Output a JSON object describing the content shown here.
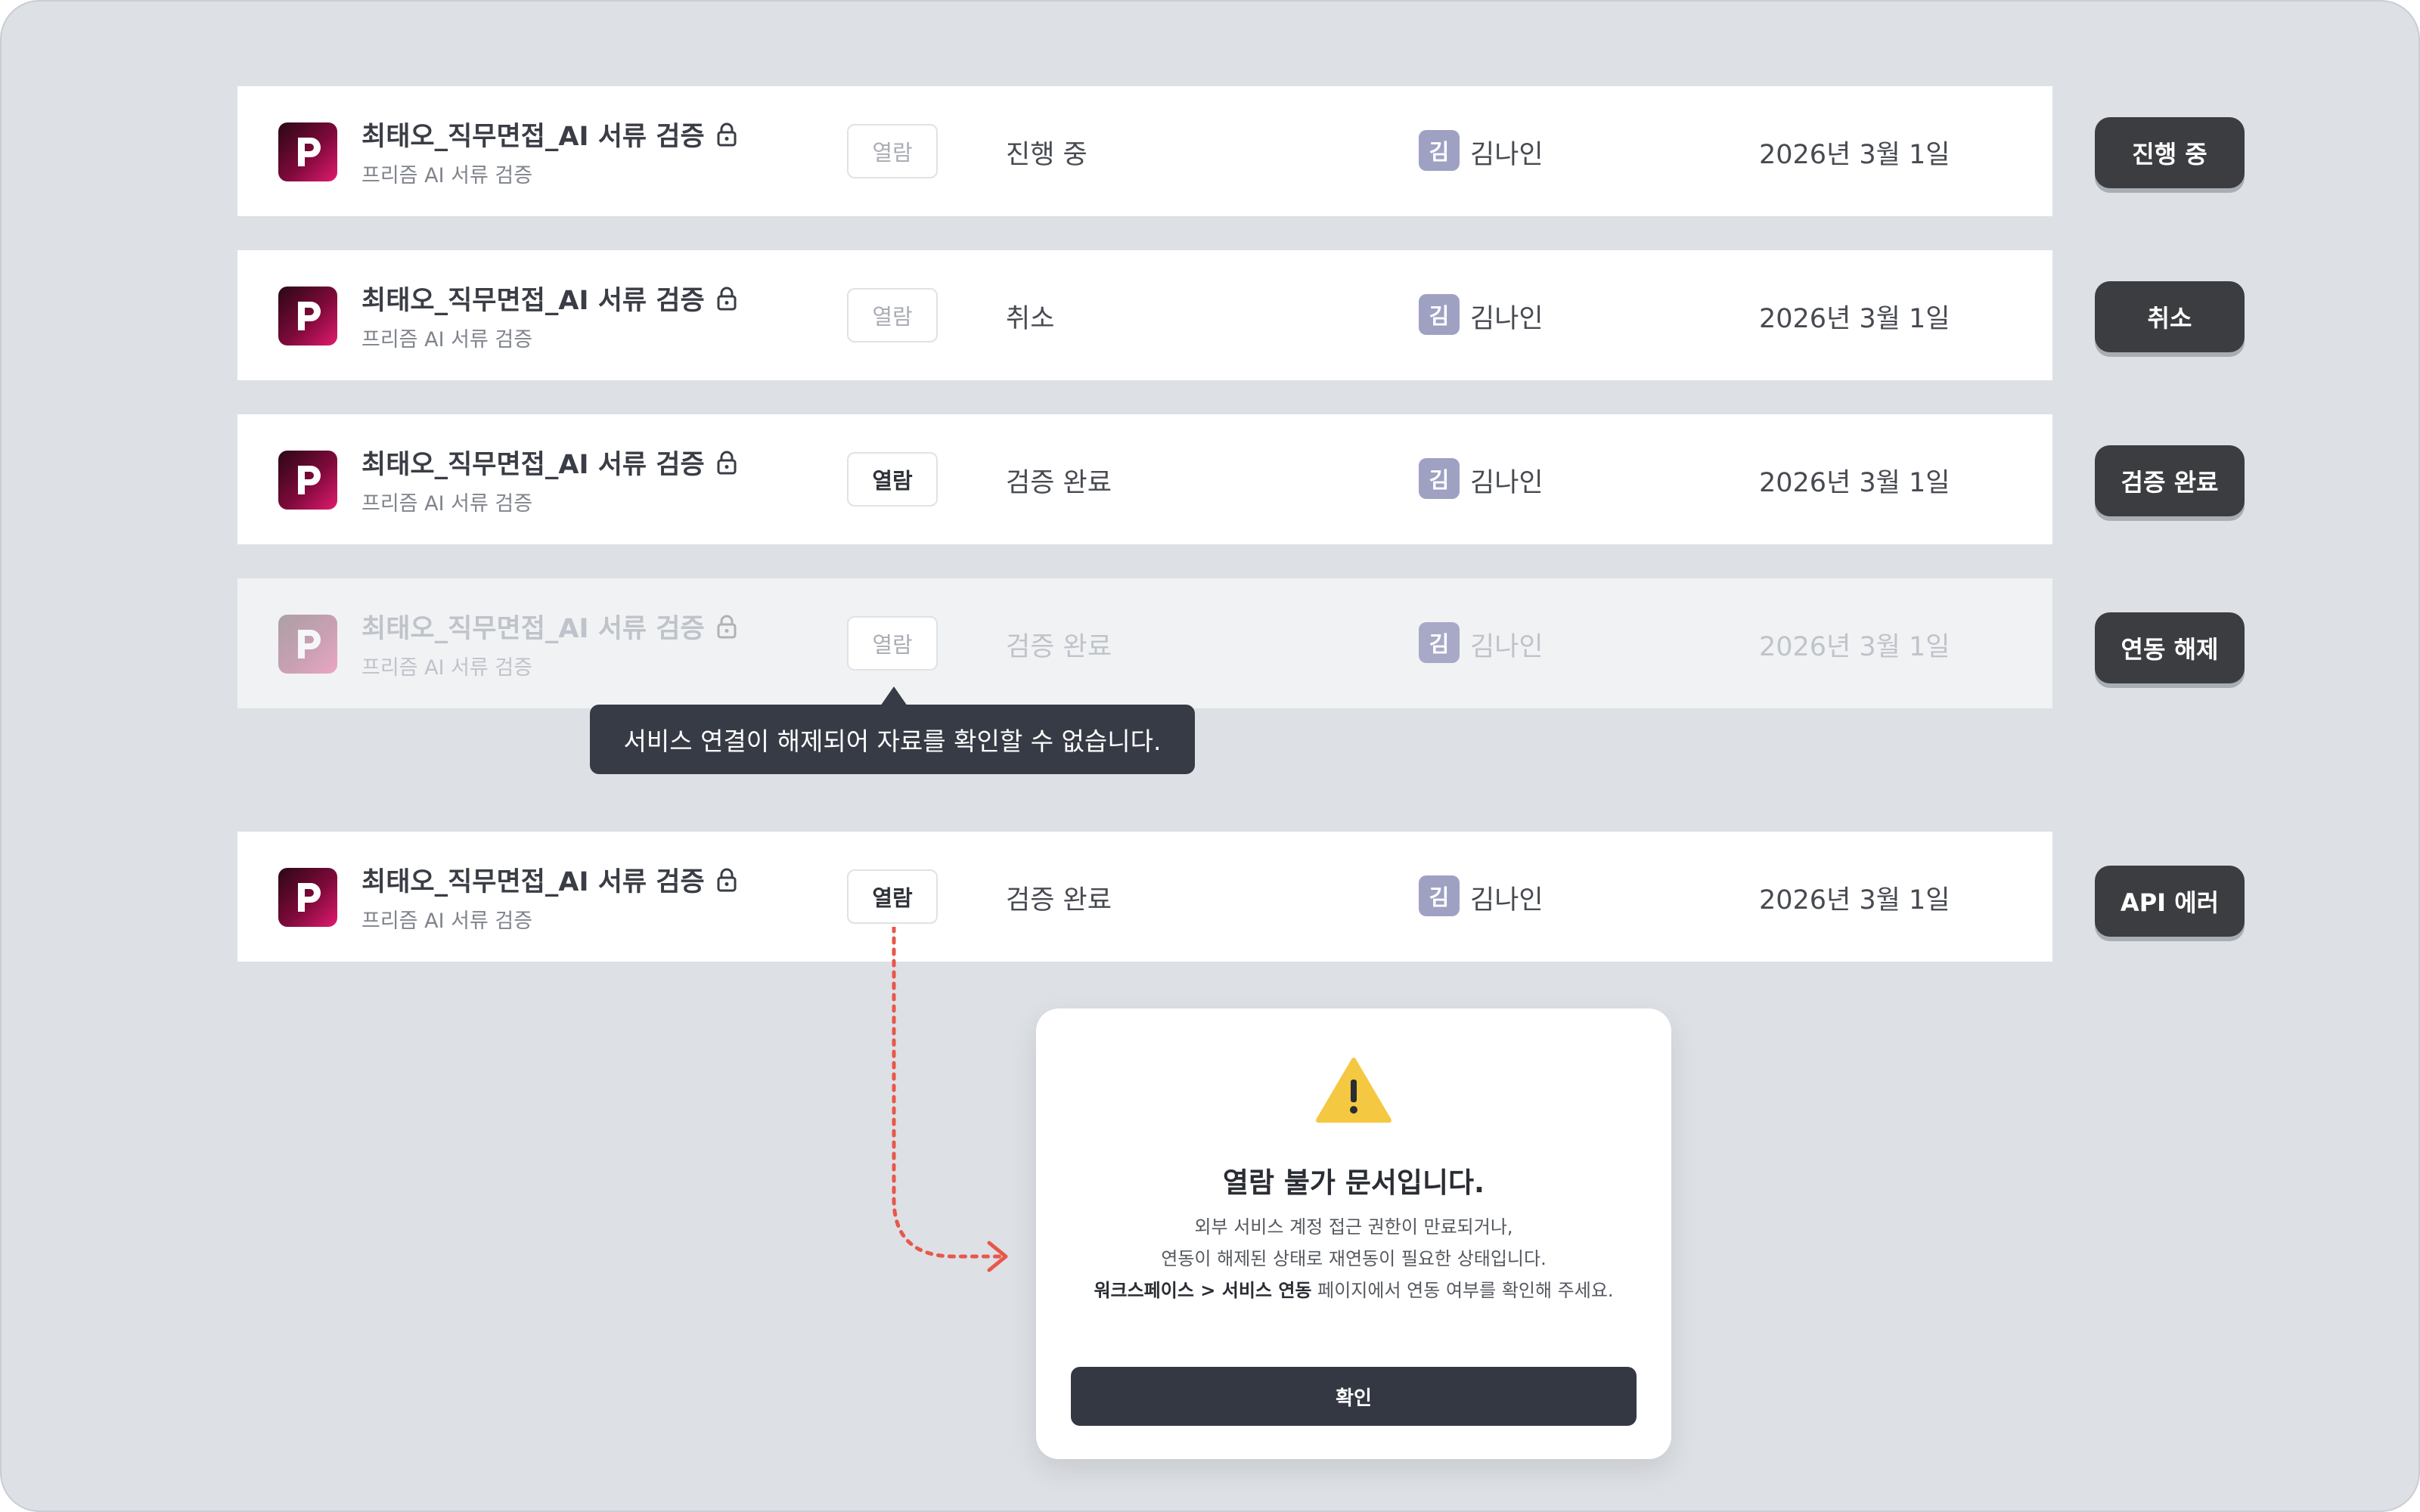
{
  "rows": [
    {
      "title": "최태오_직무면접_AI 서류 검증",
      "subtitle": "프리즘 AI 서류 검증",
      "view_label": "열람",
      "status": "진행 중",
      "avatar": "김",
      "user": "김나인",
      "date": "2026년 3월 1일",
      "state_button": "진행 중"
    },
    {
      "title": "최태오_직무면접_AI 서류 검증",
      "subtitle": "프리즘 AI 서류 검증",
      "view_label": "열람",
      "status": "취소",
      "avatar": "김",
      "user": "김나인",
      "date": "2026년 3월 1일",
      "state_button": "취소"
    },
    {
      "title": "최태오_직무면접_AI 서류 검증",
      "subtitle": "프리즘 AI 서류 검증",
      "view_label": "열람",
      "status": "검증 완료",
      "avatar": "김",
      "user": "김나인",
      "date": "2026년 3월 1일",
      "state_button": "검증 완료"
    },
    {
      "title": "최태오_직무면접_AI 서류 검증",
      "subtitle": "프리즘 AI 서류 검증",
      "view_label": "열람",
      "status": "검증 완료",
      "avatar": "김",
      "user": "김나인",
      "date": "2026년 3월 1일",
      "state_button": "연동 해제"
    },
    {
      "title": "최태오_직무면접_AI 서류 검증",
      "subtitle": "프리즘 AI 서류 검증",
      "view_label": "열람",
      "status": "검증 완료",
      "avatar": "김",
      "user": "김나인",
      "date": "2026년 3월 1일",
      "state_button": "API 에러"
    }
  ],
  "tooltip": "서비스 연결이 해제되어 자료를 확인할 수 없습니다.",
  "modal": {
    "icon": "warning-triangle-icon",
    "title": "열람 불가 문서입니다.",
    "line1": "외부 서비스 계정 접근 권한이 만료되거나,",
    "line2": "연동이 해제된 상태로 재연동이 필요한 상태입니다.",
    "line3_bold": "워크스페이스 > 서비스 연동",
    "line3_rest": " 페이지에서 연동 여부를 확인해 주세요.",
    "confirm_label": "확인"
  },
  "colors": {
    "accent_dark": "#343843",
    "avatar_bg": "#9fa1c3",
    "warning": "#f5c842",
    "connector": "#e8574a",
    "brand": "#7e0a3a"
  }
}
